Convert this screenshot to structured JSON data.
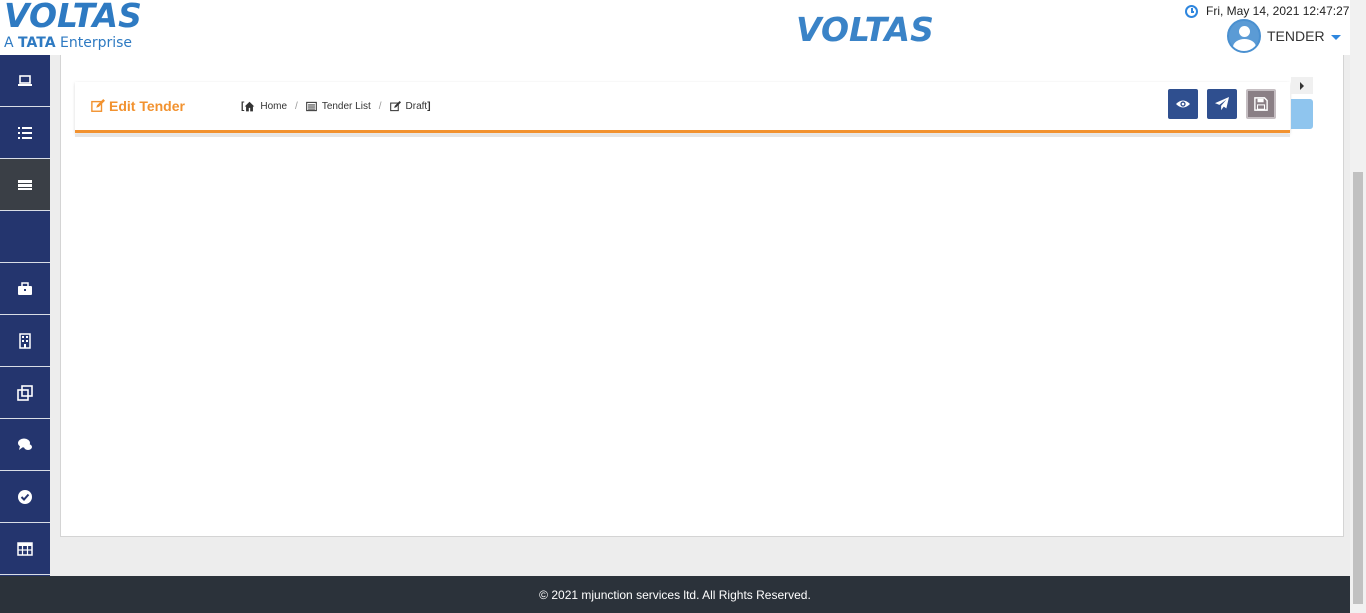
{
  "header": {
    "logo_left_brand": "VOLTAS",
    "logo_left_sub_prefix": "A",
    "logo_left_sub_tata": "TATA",
    "logo_left_sub_suffix": "Enterprise",
    "logo_center": "VOLTAS",
    "datetime": "Fri, May 14, 2021 12:47:27",
    "user_name": "TENDER"
  },
  "sidebar": {
    "items": [
      {
        "icon": "laptop-icon"
      },
      {
        "icon": "list-icon"
      },
      {
        "icon": "server-icon",
        "active": true
      },
      {
        "icon": "blank"
      },
      {
        "icon": "briefcase-icon"
      },
      {
        "icon": "building-icon"
      },
      {
        "icon": "clone-icon"
      },
      {
        "icon": "comments-icon"
      },
      {
        "icon": "check-circle-icon"
      },
      {
        "icon": "table-icon"
      }
    ]
  },
  "panel": {
    "title": "Edit Tender",
    "breadcrumb": {
      "open_bracket": "[",
      "home": "Home",
      "sep1": "/",
      "tender_list": "Tender List",
      "sep2": "/",
      "draft": "Draft",
      "close_bracket": "]"
    },
    "actions": [
      {
        "icon": "eye-icon",
        "label": "View"
      },
      {
        "icon": "paper-plane-icon",
        "label": "Send"
      },
      {
        "icon": "save-icon",
        "label": "Save"
      }
    ]
  },
  "footer": {
    "text": "© 2021 mjunction services ltd. All Rights Reserved."
  },
  "colors": {
    "sidebar_bg": "#24356e",
    "accent_orange": "#f2922f",
    "brand_blue": "#2e7ac2",
    "button_blue": "#2f4f8f",
    "footer_bg": "#2b323a"
  }
}
